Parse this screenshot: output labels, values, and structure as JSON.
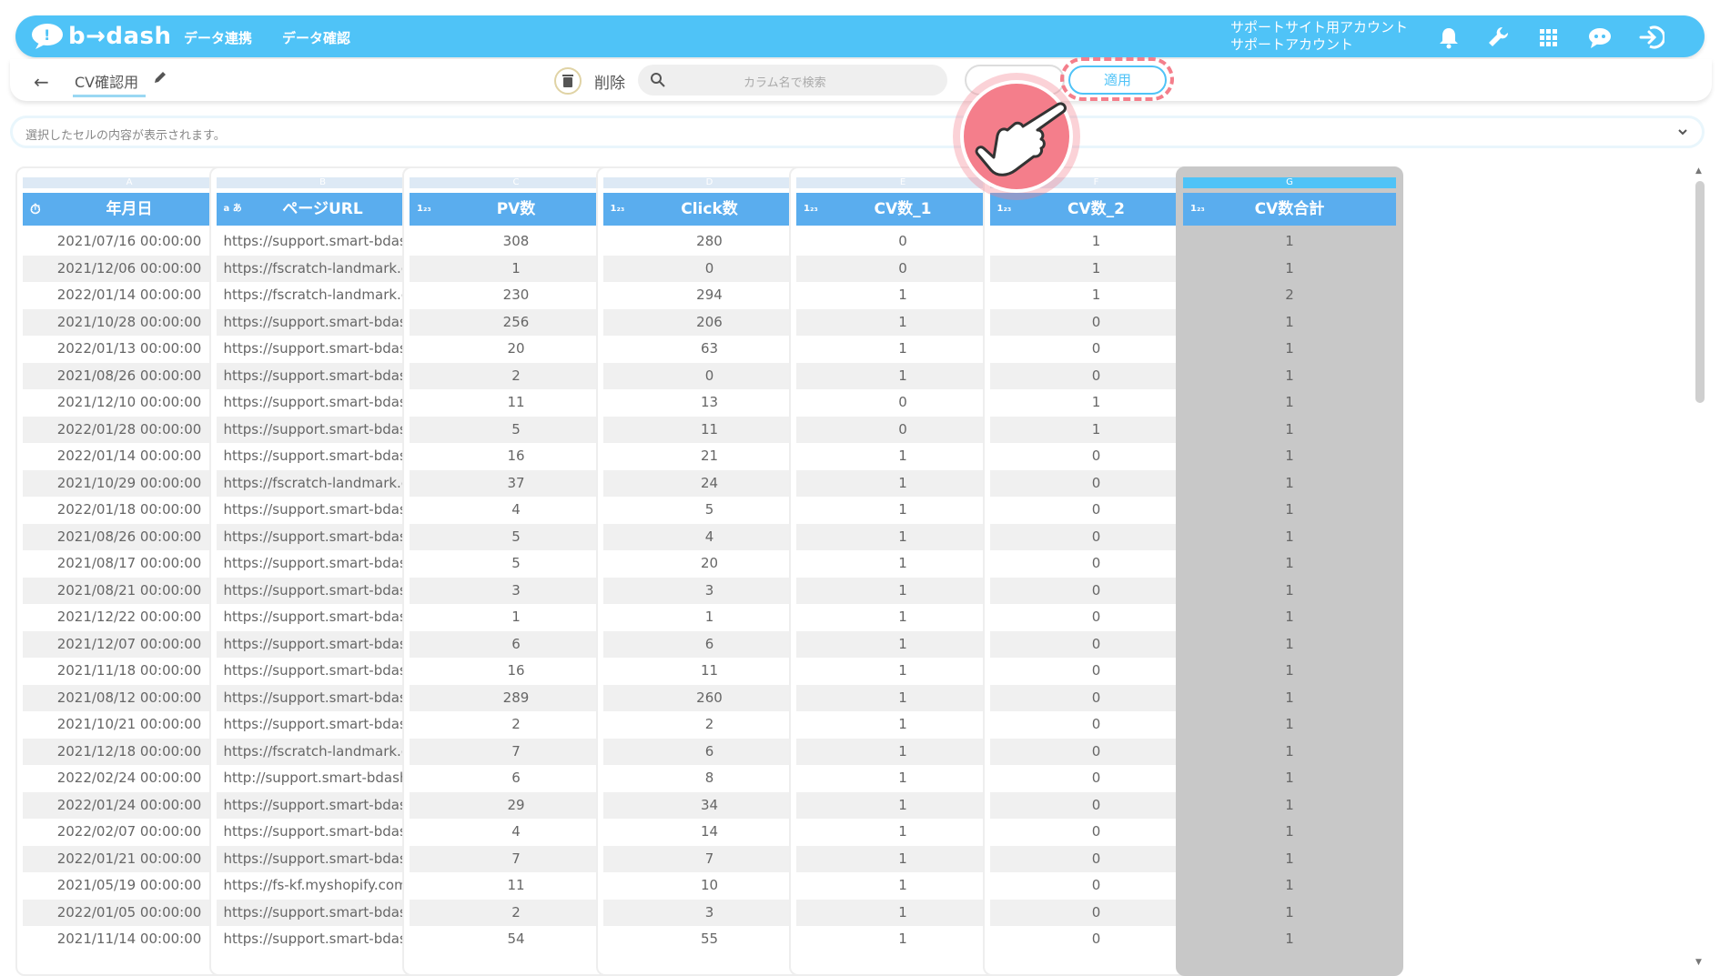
{
  "brand": {
    "name": "b→dash"
  },
  "nav": {
    "data_link": "データ連携",
    "data_check": "データ確認"
  },
  "account": {
    "line1": "サポートサイト用アカウント",
    "line2": "サポートアカウント"
  },
  "toolbar": {
    "file_name": "CV確認用",
    "delete_label": "削除",
    "search_placeholder": "カラム名で検索",
    "apply_label": "適用"
  },
  "cell_viewer": {
    "placeholder": "選択したセルの内容が表示されます。"
  },
  "columns": [
    {
      "letter": "A",
      "type_icon": "clock",
      "name": "年月日",
      "selected": false,
      "align": "center"
    },
    {
      "letter": "B",
      "type_icon": "text",
      "name": "ページURL",
      "selected": false,
      "align": "left"
    },
    {
      "letter": "C",
      "type_icon": "number",
      "name": "PV数",
      "selected": false,
      "align": "center"
    },
    {
      "letter": "D",
      "type_icon": "number",
      "name": "Click数",
      "selected": false,
      "align": "center"
    },
    {
      "letter": "E",
      "type_icon": "number",
      "name": "CV数_1",
      "selected": false,
      "align": "center"
    },
    {
      "letter": "F",
      "type_icon": "number",
      "name": "CV数_2",
      "selected": false,
      "align": "center"
    },
    {
      "letter": "G",
      "type_icon": "number",
      "name": "CV数合計",
      "selected": true,
      "align": "center"
    }
  ],
  "rows": [
    [
      "2021/07/16 00:00:00",
      "https://support.smart-bdash...",
      "308",
      "280",
      "0",
      "1",
      "1"
    ],
    [
      "2021/12/06 00:00:00",
      "https://fscratch-landmark.co...",
      "1",
      "0",
      "0",
      "1",
      "1"
    ],
    [
      "2022/01/14 00:00:00",
      "https://fscratch-landmark.co...",
      "230",
      "294",
      "1",
      "1",
      "2"
    ],
    [
      "2021/10/28 00:00:00",
      "https://support.smart-bdash...",
      "256",
      "206",
      "1",
      "0",
      "1"
    ],
    [
      "2022/01/13 00:00:00",
      "https://support.smart-bdash...",
      "20",
      "63",
      "1",
      "0",
      "1"
    ],
    [
      "2021/08/26 00:00:00",
      "https://support.smart-bdash...",
      "2",
      "0",
      "1",
      "0",
      "1"
    ],
    [
      "2021/12/10 00:00:00",
      "https://support.smart-bdash...",
      "11",
      "13",
      "0",
      "1",
      "1"
    ],
    [
      "2022/01/28 00:00:00",
      "https://support.smart-bdash...",
      "5",
      "11",
      "0",
      "1",
      "1"
    ],
    [
      "2022/01/14 00:00:00",
      "https://support.smart-bdash...",
      "16",
      "21",
      "1",
      "0",
      "1"
    ],
    [
      "2021/10/29 00:00:00",
      "https://fscratch-landmark.co...",
      "37",
      "24",
      "1",
      "0",
      "1"
    ],
    [
      "2022/01/18 00:00:00",
      "https://support.smart-bdash...",
      "4",
      "5",
      "1",
      "0",
      "1"
    ],
    [
      "2021/08/26 00:00:00",
      "https://support.smart-bdash...",
      "5",
      "4",
      "1",
      "0",
      "1"
    ],
    [
      "2021/08/17 00:00:00",
      "https://support.smart-bdash...",
      "5",
      "20",
      "1",
      "0",
      "1"
    ],
    [
      "2021/08/21 00:00:00",
      "https://support.smart-bdash...",
      "3",
      "3",
      "1",
      "0",
      "1"
    ],
    [
      "2021/12/22 00:00:00",
      "https://support.smart-bdash...",
      "1",
      "1",
      "1",
      "0",
      "1"
    ],
    [
      "2021/12/07 00:00:00",
      "https://support.smart-bdash...",
      "6",
      "6",
      "1",
      "0",
      "1"
    ],
    [
      "2021/11/18 00:00:00",
      "https://support.smart-bdash...",
      "16",
      "11",
      "1",
      "0",
      "1"
    ],
    [
      "2021/08/12 00:00:00",
      "https://support.smart-bdash...",
      "289",
      "260",
      "1",
      "0",
      "1"
    ],
    [
      "2021/10/21 00:00:00",
      "https://support.smart-bdash...",
      "2",
      "2",
      "1",
      "0",
      "1"
    ],
    [
      "2021/12/18 00:00:00",
      "https://fscratch-landmark.co...",
      "7",
      "6",
      "1",
      "0",
      "1"
    ],
    [
      "2022/02/24 00:00:00",
      "http://support.smart-bdash....",
      "6",
      "8",
      "1",
      "0",
      "1"
    ],
    [
      "2022/01/24 00:00:00",
      "https://support.smart-bdash...",
      "29",
      "34",
      "1",
      "0",
      "1"
    ],
    [
      "2022/02/07 00:00:00",
      "https://support.smart-bdash...",
      "4",
      "14",
      "1",
      "0",
      "1"
    ],
    [
      "2022/01/21 00:00:00",
      "https://support.smart-bdash...",
      "7",
      "7",
      "1",
      "0",
      "1"
    ],
    [
      "2021/05/19 00:00:00",
      "https://fs-kf.myshopify.com/...",
      "11",
      "10",
      "1",
      "0",
      "1"
    ],
    [
      "2022/01/05 00:00:00",
      "https://support.smart-bdash...",
      "2",
      "3",
      "1",
      "0",
      "1"
    ],
    [
      "2021/11/14 00:00:00",
      "https://support.smart-bdash...",
      "54",
      "55",
      "1",
      "0",
      "1"
    ]
  ],
  "colors": {
    "brand": "#4fc3f7",
    "header": "#5aadee",
    "highlight": "#f47e8b",
    "selected_column": "#c8c8c8"
  },
  "icons": [
    "bell-icon",
    "wrench-icon",
    "grid-icon",
    "chat-bot-icon",
    "logout-icon",
    "back-arrow-icon",
    "pencil-icon",
    "trash-icon",
    "search-icon",
    "chevron-down-icon",
    "pointing-hand-icon"
  ]
}
